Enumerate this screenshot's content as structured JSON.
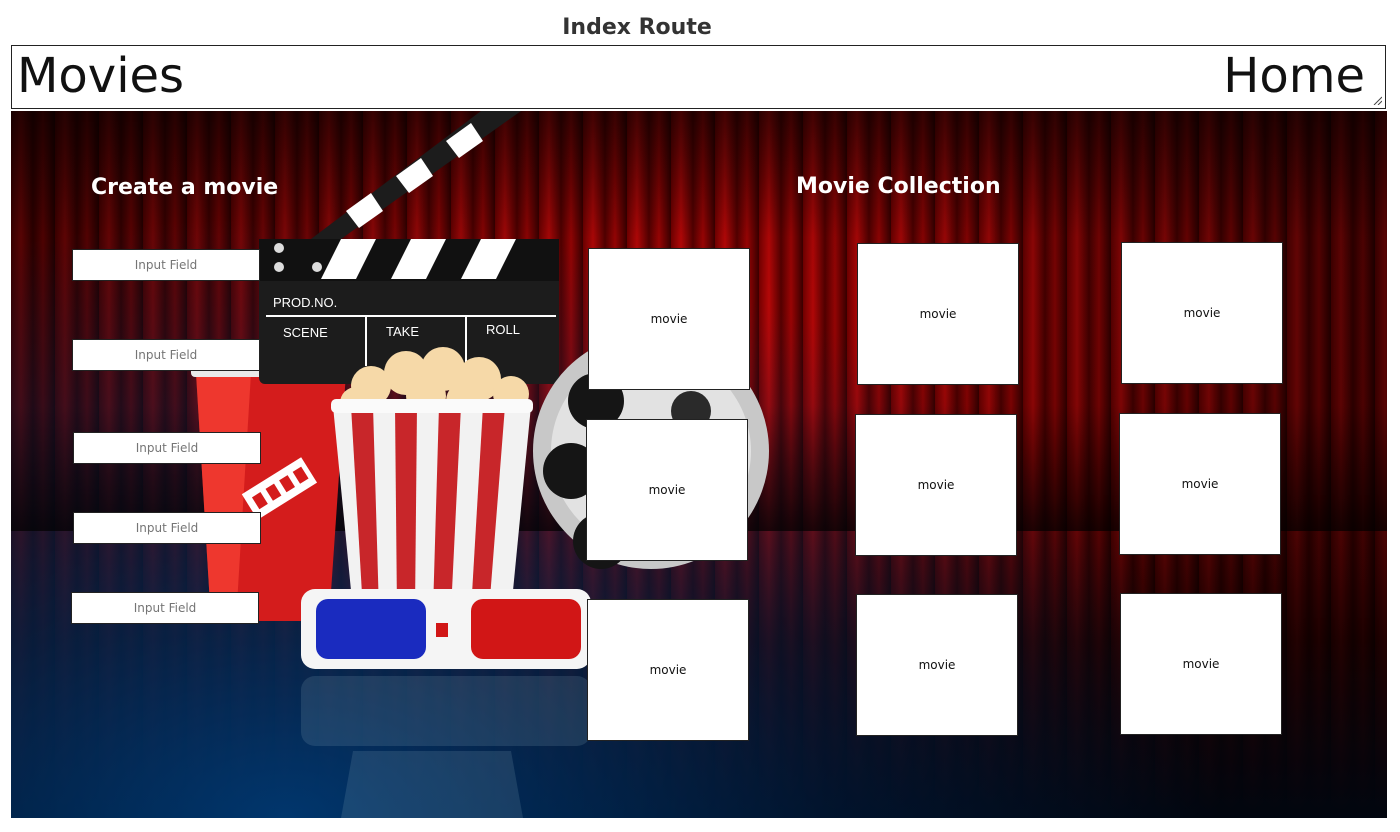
{
  "page": {
    "route_title": "Index Route"
  },
  "header": {
    "brand": "Movies",
    "home_link": "Home"
  },
  "create": {
    "heading": "Create a movie",
    "fields": [
      {
        "placeholder": "Input Field"
      },
      {
        "placeholder": "Input Field"
      },
      {
        "placeholder": "Input Field"
      },
      {
        "placeholder": "Input Field"
      },
      {
        "placeholder": "Input Field"
      }
    ]
  },
  "collection": {
    "heading": "Movie Collection",
    "movies": [
      {
        "label": "movie"
      },
      {
        "label": "movie"
      },
      {
        "label": "movie"
      },
      {
        "label": "movie"
      },
      {
        "label": "movie"
      },
      {
        "label": "movie"
      },
      {
        "label": "movie"
      },
      {
        "label": "movie"
      },
      {
        "label": "movie"
      }
    ]
  },
  "clapperboard": {
    "prod": "PROD.NO.",
    "scene": "SCENE",
    "take": "TAKE",
    "roll": "ROLL"
  },
  "colors": {
    "curtain": "#b00000",
    "floor": "#003a6e",
    "accent_red": "#d41c1c"
  },
  "icons": [
    "resize-handle-icon",
    "clapperboard-icon",
    "popcorn-icon",
    "film-reel-icon",
    "soda-cup-icon",
    "3d-glasses-icon",
    "ticket-icon"
  ]
}
